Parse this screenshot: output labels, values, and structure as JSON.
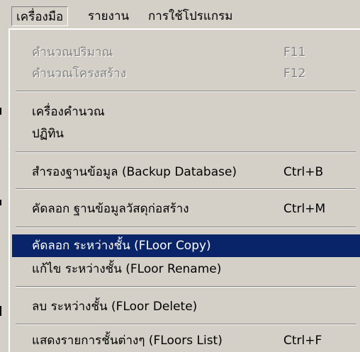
{
  "menubar": {
    "items": [
      {
        "label": "เครื่องมือ"
      },
      {
        "label": "รายงาน"
      },
      {
        "label": "การใช้โปรแกรม"
      }
    ]
  },
  "menu": {
    "items": [
      {
        "label": "คำนวณปริมาณ",
        "shortcut": "F11"
      },
      {
        "label": "คำนวณโครงสร้าง",
        "shortcut": "F12"
      },
      {
        "label": "เครื่องคำนวณ"
      },
      {
        "label": "ปฏิทิน"
      },
      {
        "label": "สำรองฐานข้อมูล (Backup Database)",
        "shortcut": "Ctrl+B"
      },
      {
        "label": "คัดลอก ฐานข้อมูลวัสดุก่อสร้าง",
        "shortcut": "Ctrl+M"
      },
      {
        "label": "คัดลอก ระหว่างชั้น (FLoor Copy)"
      },
      {
        "label": "แก้ไข ระหว่างชั้น (FLoor Rename)"
      },
      {
        "label": "ลบ ระหว่างชั้น (FLoor Delete)"
      },
      {
        "label": "แสดงรายการชั้นต่างๆ (FLoors List)",
        "shortcut": "Ctrl+F"
      }
    ]
  },
  "colors": {
    "menu_background": "#d4d0c8",
    "highlight": "#0a246a",
    "disabled_text": "#808080"
  }
}
